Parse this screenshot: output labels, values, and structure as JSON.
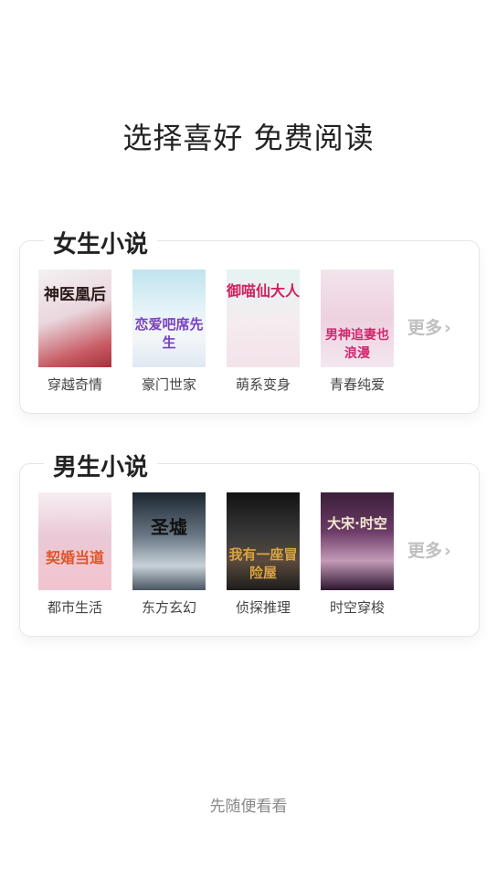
{
  "page_title": "选择喜好 免费阅读",
  "sections": [
    {
      "title": "女生小说",
      "more_label": "更多",
      "books": [
        {
          "cover_text": "神医凰后",
          "label": "穿越奇情"
        },
        {
          "cover_text": "恋爱吧席先生",
          "label": "豪门世家"
        },
        {
          "cover_text": "御喵仙大人",
          "label": "萌系变身"
        },
        {
          "cover_text": "男神追妻也浪漫",
          "label": "青春纯爱"
        }
      ]
    },
    {
      "title": "男生小说",
      "more_label": "更多",
      "books": [
        {
          "cover_text": "契婚当道",
          "label": "都市生活"
        },
        {
          "cover_text": "圣墟",
          "label": "东方玄幻"
        },
        {
          "cover_text": "我有一座冒险屋",
          "label": "侦探推理"
        },
        {
          "cover_text": "大宋·时空",
          "label": "时空穿梭"
        }
      ]
    }
  ],
  "footer_link": "先随便看看"
}
